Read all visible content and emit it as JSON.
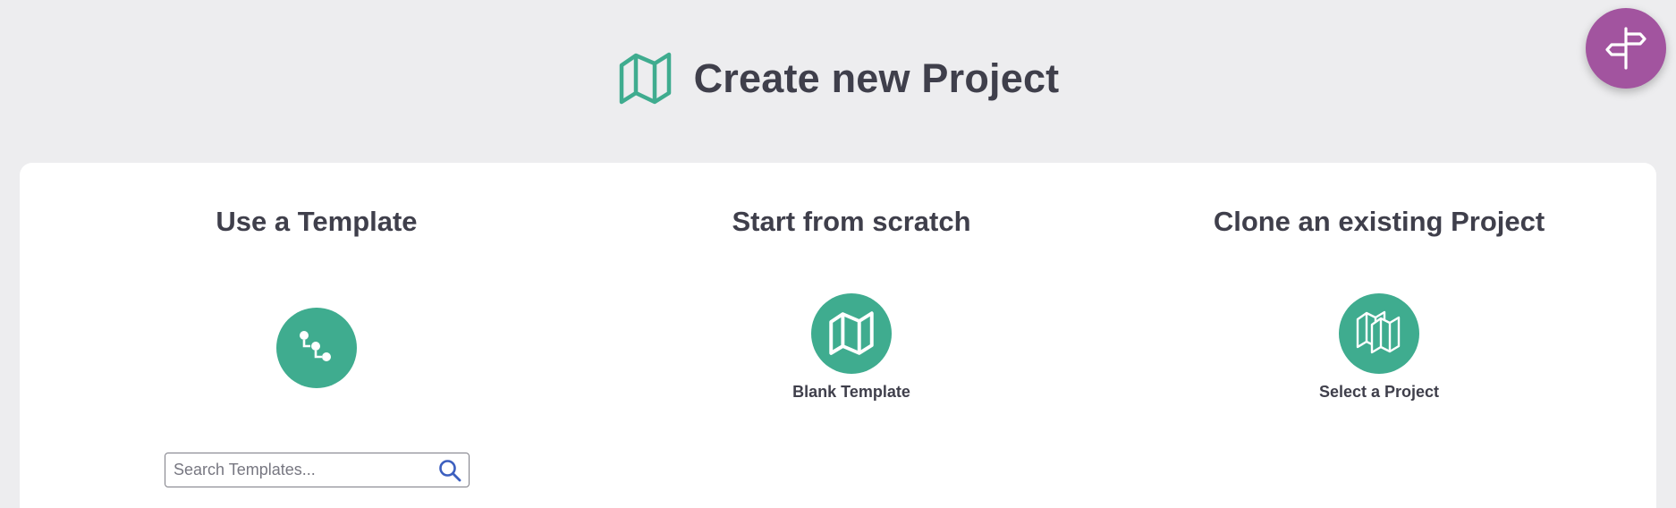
{
  "header": {
    "title": "Create new Project",
    "icon": "map-icon"
  },
  "help_button": {
    "icon": "signpost-icon"
  },
  "options": {
    "template": {
      "heading": "Use a Template",
      "icon": "template-tree-icon",
      "search": {
        "placeholder": "Search Templates...",
        "value": "",
        "icon": "search-icon"
      }
    },
    "scratch": {
      "heading": "Start from scratch",
      "icon": "map-icon",
      "label": "Blank Template"
    },
    "clone": {
      "heading": "Clone an existing Project",
      "icon": "maps-stack-icon",
      "label": "Select a Project"
    }
  },
  "colors": {
    "background": "#ededef",
    "panel": "#ffffff",
    "accent_green": "#3fac8f",
    "help_purple": "#a2549f",
    "text": "#3f3f4b",
    "search_icon": "#3c5fbf"
  }
}
